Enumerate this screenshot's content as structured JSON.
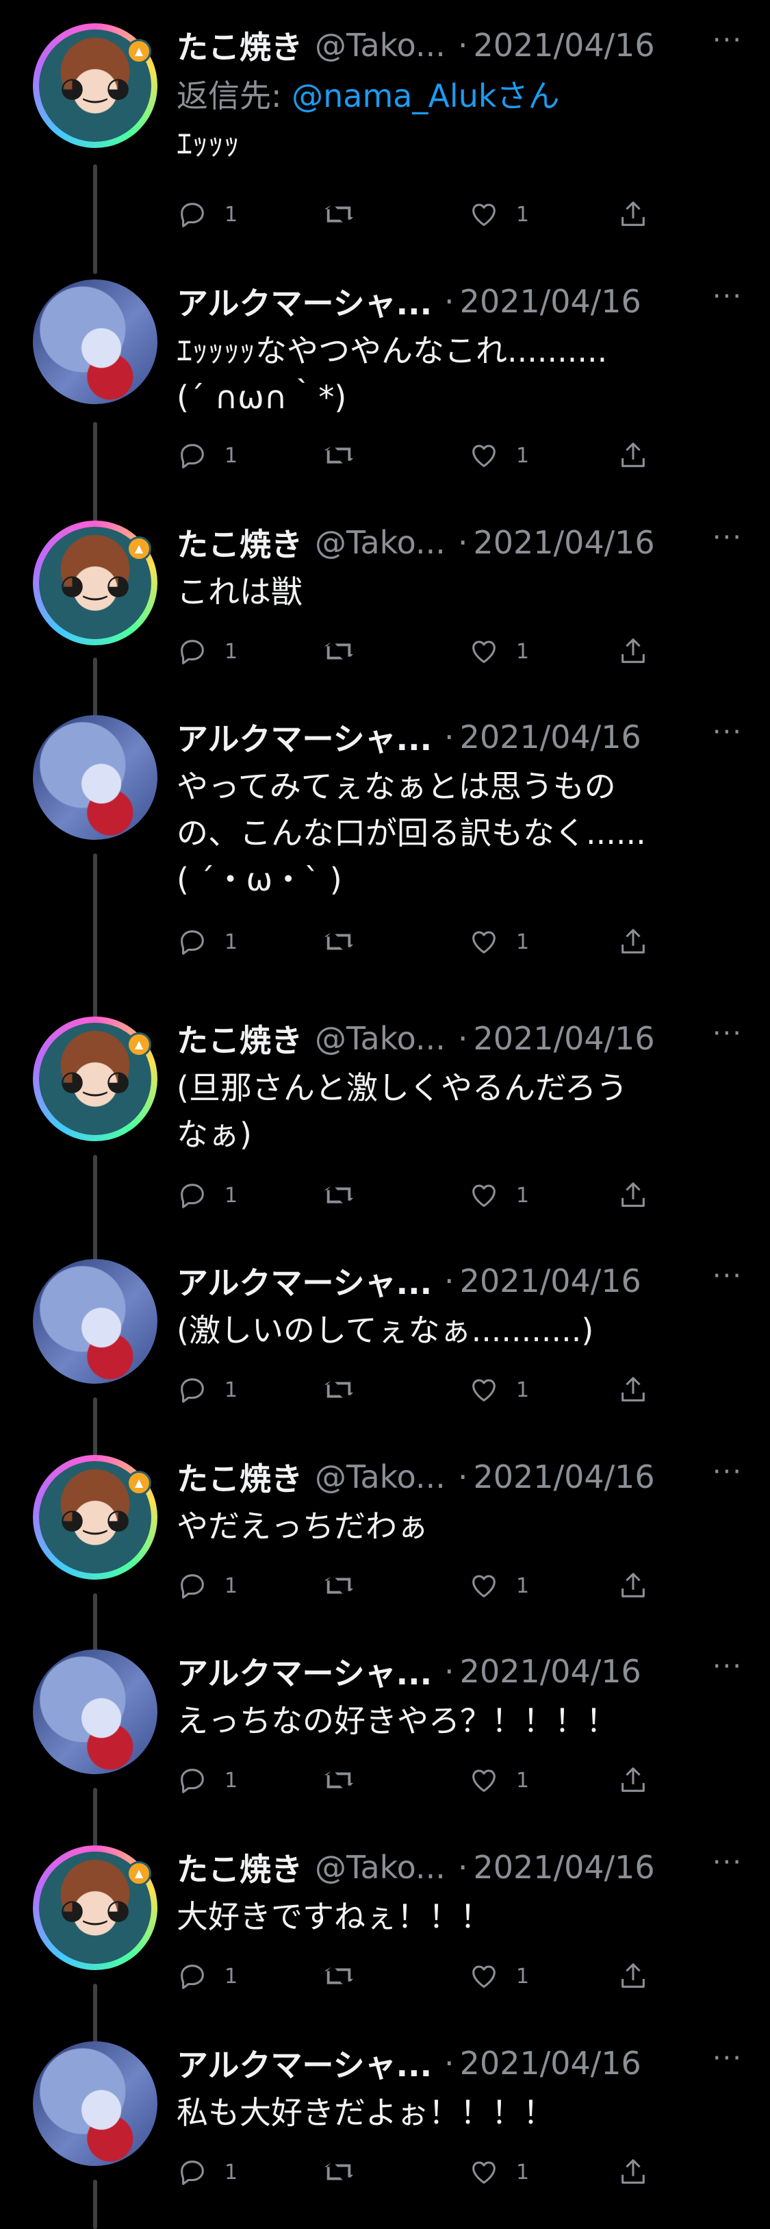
{
  "tweets": [
    {
      "name": "たこ焼き",
      "handle": "@Tako...",
      "dot": "·",
      "date": "2021/04/16",
      "reply_label": "返信先:",
      "reply_to": "@nama_Alukさん",
      "text": "ｴｯｯｯ",
      "replies": "1",
      "likes": "1"
    },
    {
      "name": "アルクマーシャ...",
      "handle": "",
      "dot": "·",
      "date": "2021/04/16",
      "text": "ｴｯｯｯｯなやつやんなこれ..........\n(´ ∩ω∩｀*)",
      "replies": "1",
      "likes": "1"
    },
    {
      "name": "たこ焼き",
      "handle": "@Tako...",
      "dot": "·",
      "date": "2021/04/16",
      "text": "これは獣",
      "replies": "1",
      "likes": "1"
    },
    {
      "name": "アルクマーシャ...",
      "handle": "",
      "dot": "·",
      "date": "2021/04/16",
      "text": "やってみてぇなぁとは思うもの\nの、こんな口が回る訳もなく......\n( ´・ω・` )",
      "replies": "1",
      "likes": "1"
    },
    {
      "name": "たこ焼き",
      "handle": "@Tako...",
      "dot": "·",
      "date": "2021/04/16",
      "text": "(旦那さんと激しくやるんだろう\nなぁ)",
      "replies": "1",
      "likes": "1"
    },
    {
      "name": "アルクマーシャ...",
      "handle": "",
      "dot": "·",
      "date": "2021/04/16",
      "text": "(激しいのしてぇなぁ...........)",
      "replies": "1",
      "likes": "1"
    },
    {
      "name": "たこ焼き",
      "handle": "@Tako...",
      "dot": "·",
      "date": "2021/04/16",
      "text": "やだえっちだわぁ",
      "replies": "1",
      "likes": "1"
    },
    {
      "name": "アルクマーシャ...",
      "handle": "",
      "dot": "·",
      "date": "2021/04/16",
      "text": "えっちなの好きやろ？！！！！",
      "replies": "1",
      "likes": "1"
    },
    {
      "name": "たこ焼き",
      "handle": "@Tako...",
      "dot": "·",
      "date": "2021/04/16",
      "text": "大好きですねぇ！！！",
      "replies": "1",
      "likes": "1"
    },
    {
      "name": "アルクマーシャ...",
      "handle": "",
      "dot": "·",
      "date": "2021/04/16",
      "text": "私も大好きだよぉ！！！！",
      "replies": "1",
      "likes": "1"
    }
  ],
  "more_glyph": "···",
  "icons": {
    "reply": "reply-icon",
    "retweet": "retweet-icon",
    "like": "heart-icon",
    "share": "share-icon"
  },
  "colors": {
    "background": "#000000",
    "link": "#1d9bf0",
    "muted": "#8b8f96"
  }
}
